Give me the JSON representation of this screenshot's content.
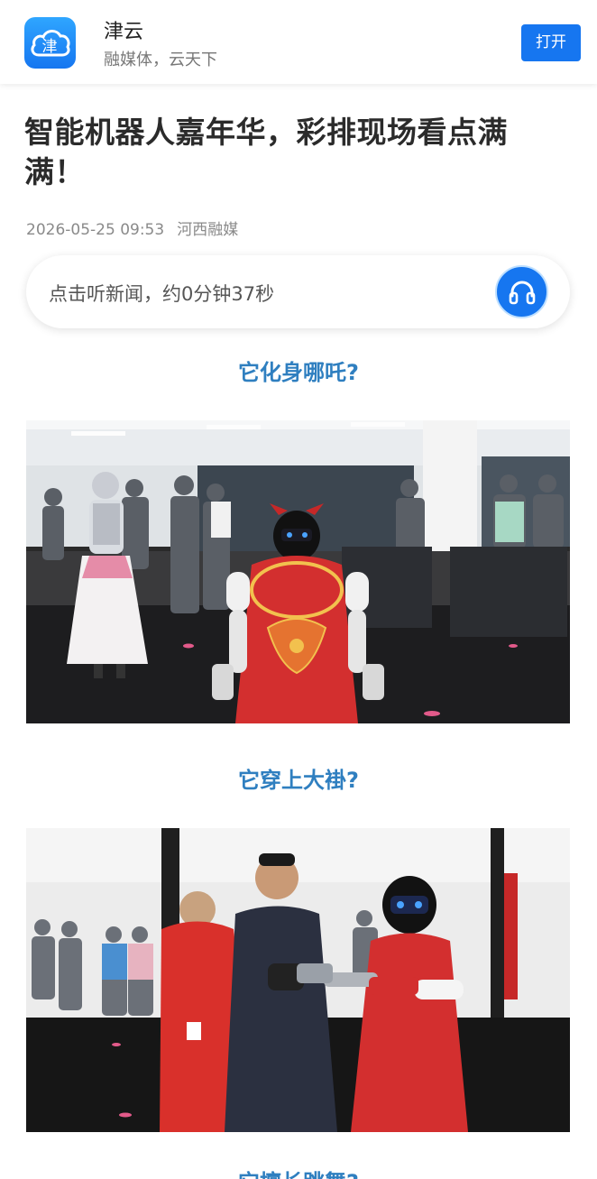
{
  "app": {
    "name": "津云",
    "slogan": "融媒体，云天下",
    "logo_char": "津",
    "open_label": "打开",
    "accent": "#1676f0"
  },
  "article": {
    "title": "智能机器人嘉年华，彩排现场看点满满！",
    "date": "2026-05-25 09:53",
    "source": "河西融媒"
  },
  "listen": {
    "text": "点击听新闻，约0分钟37秒",
    "icon": "headphones-icon"
  },
  "sections": [
    {
      "heading": "它化身哪吒?"
    },
    {
      "heading": "它穿上大褂?"
    },
    {
      "heading": "它擅长跳舞?"
    }
  ]
}
